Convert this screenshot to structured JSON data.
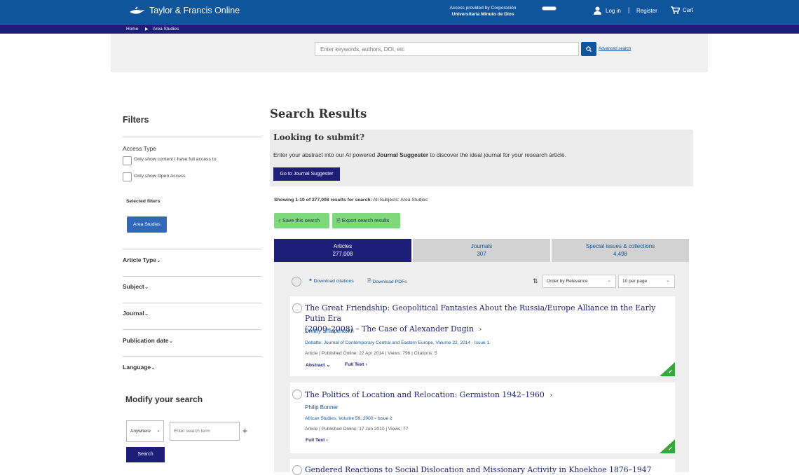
{
  "header": {
    "logo_text": "Taylor & Francis Online",
    "access_line1": "Access provided by Corporación",
    "access_line2": "Universitaria Minuto de Dios",
    "login": "Log in",
    "register": "Register",
    "cart": "Cart"
  },
  "breadcrumb": [
    "Home",
    "Area Studies"
  ],
  "search": {
    "placeholder": "Enter keywords, authors, DOI, etc",
    "advanced": "Advanced search"
  },
  "filters": {
    "title": "Filters",
    "access_type": "Access Type",
    "checkbox_full": "Only show content I have full access to",
    "checkbox_oa": "Only show Open Access",
    "selected_title": "Selected filters",
    "selected_pill": "Area Studies",
    "facets": [
      "Article Type",
      "Subject",
      "Journal",
      "Publication date",
      "Language"
    ]
  },
  "modify": {
    "title": "Modify your search",
    "field": "Anywhere",
    "term_placeholder": "Enter search term",
    "button": "Search"
  },
  "results": {
    "title": "Search Results",
    "promo_title": "Looking to submit?",
    "promo_text_pre": "Enter your abstract into our AI powered ",
    "promo_text_bold": "Journal Suggester",
    "promo_text_post": " to discover the ideal journal for your research article.",
    "promo_button": "Go to Journal Suggester",
    "showing_bold": "Showing 1-10 of 277,008 results for search:",
    "showing_rest": " All Subjects: Area Studies",
    "save_search": "Save this search",
    "export": "Export search results",
    "tabs": [
      {
        "label": "Articles",
        "count": "277,008"
      },
      {
        "label": "Journals",
        "count": "307"
      },
      {
        "label": "Special issues & collections",
        "count": "4,498"
      }
    ],
    "download_citations": "Download citations",
    "download_pdfs": "Download PDFs",
    "order": "Order by Relevance",
    "per_page": "10 per page",
    "items": [
      {
        "title_line1": "The Great Friendship: Geopolitical Fantasies About the Russia/Europe Alliance in the Early Putin Era",
        "title_line2": "(2000–2008) – The Case of Alexander Dugin",
        "author": "Dmitry Shlapentokh",
        "source": "Debatte: Journal of Contemporary Central and Eastern Europe, Volume 22, 2014 - Issue 1",
        "meta": "Article | Published Online: 22 Apr 2014 | Views: 796 | Citations: 5",
        "abstract": "Abstract",
        "fulltext": "Full Text"
      },
      {
        "title_line1": "The Politics of Location and Relocation: Germiston 1942–1960",
        "author": "Philip Bonner",
        "source": "African Studies, Volume 59, 2000 - Issue 2",
        "meta": "Article | Published Online: 17 Jun 2010 | Views: 77",
        "fulltext": "Full Text"
      },
      {
        "title_line1": "Gendered Reactions to Social Dislocation and Missionary Activity in Khoekhoe 1876–1947"
      }
    ]
  },
  "colors": {
    "brand_blue": "#10549c",
    "navy": "#1c1e78",
    "green": "#7dd97b"
  }
}
